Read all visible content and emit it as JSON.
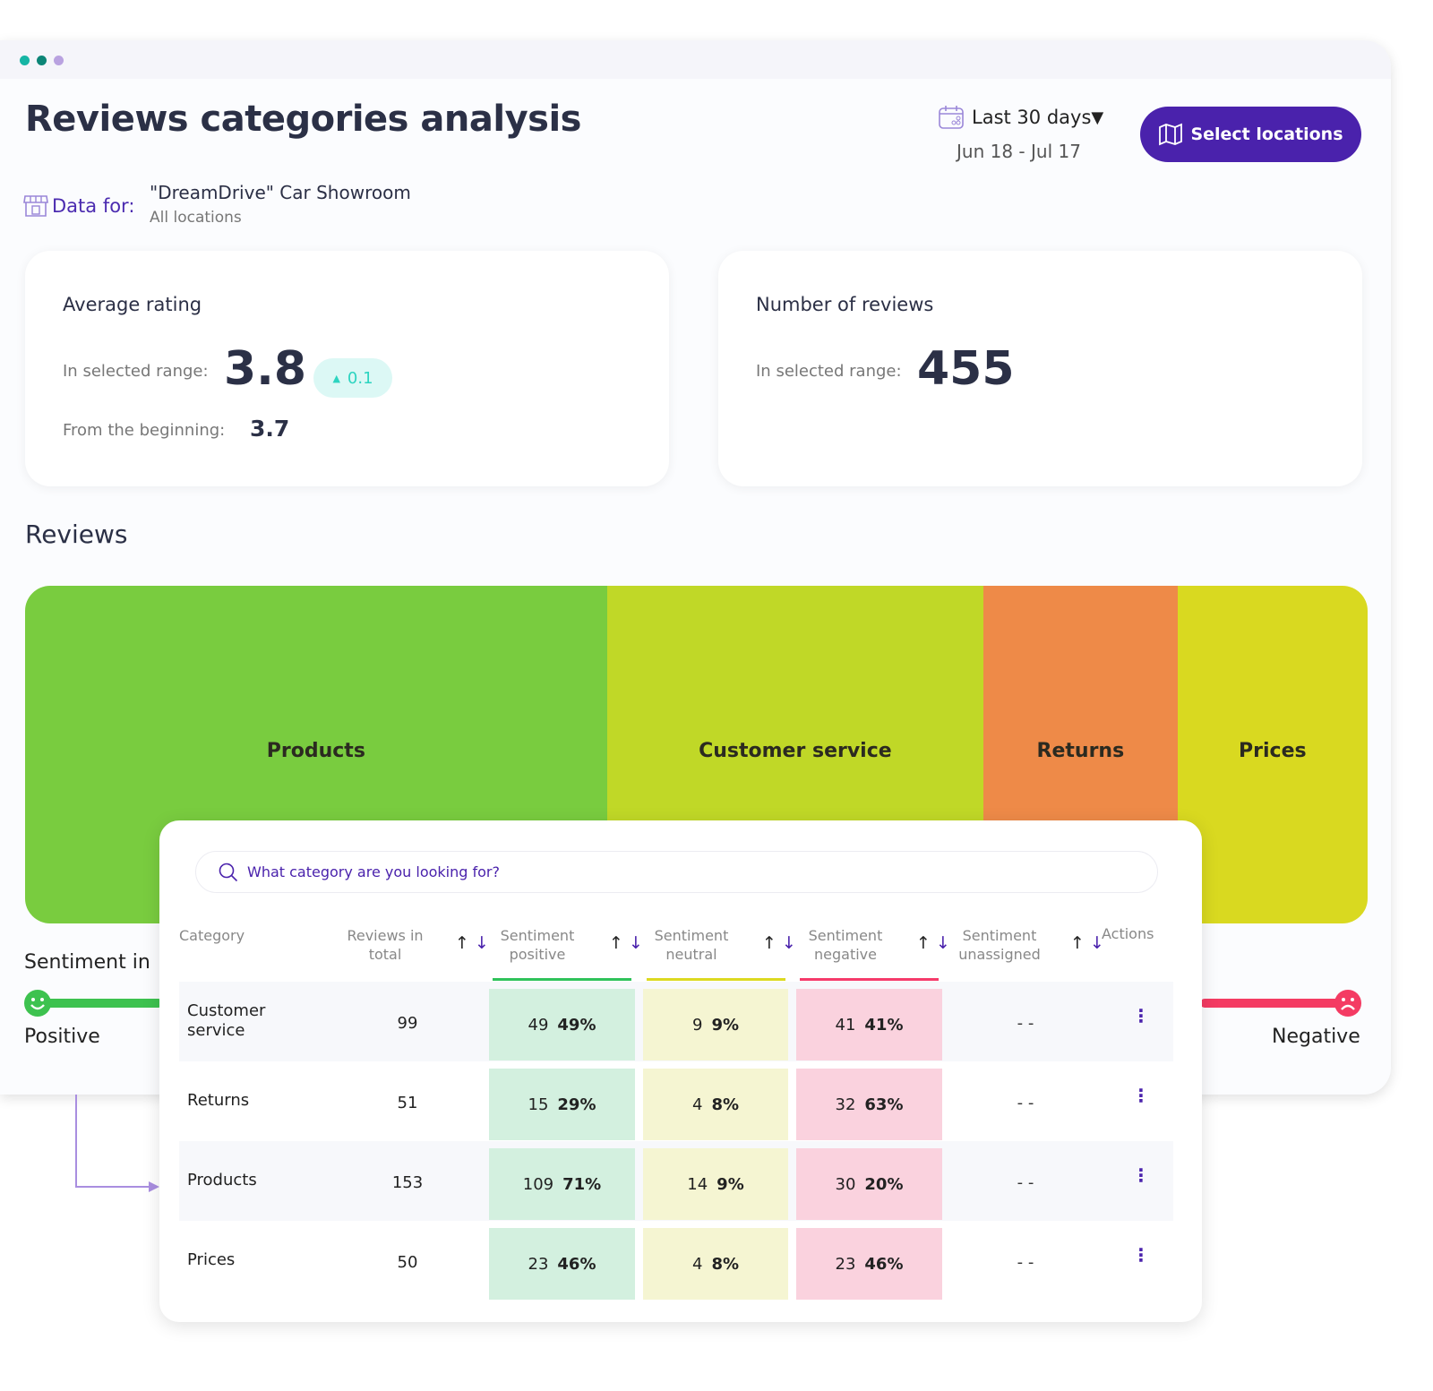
{
  "window": {
    "dot_colors": [
      "#16b5a5",
      "#0d8577",
      "#b9a2e0"
    ]
  },
  "header": {
    "title": "Reviews categories analysis",
    "data_for_label": "Data for:",
    "business_name": "\"DreamDrive\" Car Showroom",
    "locations": "All locations",
    "range_label": "Last 30 days",
    "date_range": "Jun 18 - Jul 17",
    "select_locations": "Select locations"
  },
  "avg_rating": {
    "title": "Average rating",
    "range_label": "In selected range:",
    "value": "3.8",
    "change": "0.1",
    "beginning_label": "From the beginning:",
    "beginning_value": "3.7"
  },
  "num_reviews": {
    "title": "Number of reviews",
    "range_label": "In selected range:",
    "value": "455"
  },
  "reviews": {
    "title": "Reviews",
    "sentiment_title": "Sentiment in",
    "positive": "Positive",
    "negative": "Negative"
  },
  "chart_data": {
    "type": "treemap",
    "categories": [
      "Products",
      "Customer service",
      "Returns",
      "Prices"
    ],
    "values": [
      153,
      99,
      51,
      50
    ],
    "colors": [
      "#79cc3f",
      "#c0d827",
      "#ee8a48",
      "#d9d920"
    ]
  },
  "table": {
    "search_placeholder": "What category are you looking for?",
    "headers": {
      "category": "Category",
      "total": "Reviews in total",
      "positive": "Sentiment positive",
      "neutral": "Sentiment neutral",
      "negative": "Sentiment negative",
      "unassigned": "Sentiment unassigned",
      "actions": "Actions"
    },
    "rows": [
      {
        "category": "Customer service",
        "total": "99",
        "pos": "49",
        "pos_pct": "49%",
        "neu": "9",
        "neu_pct": "9%",
        "neg": "41",
        "neg_pct": "41%",
        "unassigned": "- -"
      },
      {
        "category": "Returns",
        "total": "51",
        "pos": "15",
        "pos_pct": "29%",
        "neu": "4",
        "neu_pct": "8%",
        "neg": "32",
        "neg_pct": "63%",
        "unassigned": "- -"
      },
      {
        "category": "Products",
        "total": "153",
        "pos": "109",
        "pos_pct": "71%",
        "neu": "14",
        "neu_pct": "9%",
        "neg": "30",
        "neg_pct": "20%",
        "unassigned": "- -"
      },
      {
        "category": "Prices",
        "total": "50",
        "pos": "23",
        "pos_pct": "46%",
        "neu": "4",
        "neu_pct": "8%",
        "neg": "23",
        "neg_pct": "46%",
        "unassigned": "- -"
      }
    ]
  }
}
